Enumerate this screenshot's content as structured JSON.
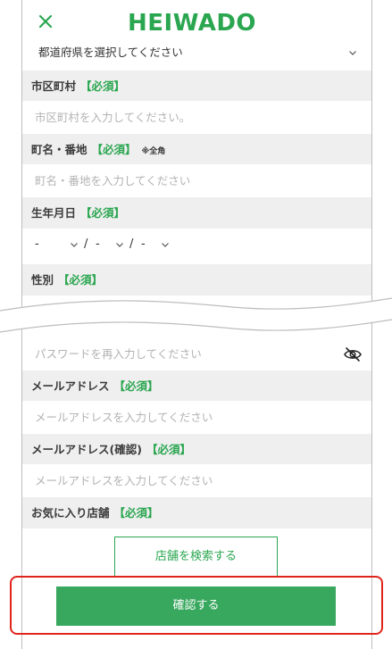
{
  "header": {
    "logo": "HEIWADO",
    "close_icon": "close-icon"
  },
  "form": {
    "prefecture_select": "都道府県を選択してください",
    "city": {
      "label": "市区町村",
      "required": "【必須】",
      "placeholder": "市区町村を入力してください。"
    },
    "street": {
      "label": "町名・番地",
      "required": "【必須】",
      "note": "※全角",
      "placeholder": "町名・番地を入力してください"
    },
    "birthdate": {
      "label": "生年月日",
      "required": "【必須】",
      "year": "-",
      "month": "-",
      "day": "-",
      "separator": "/"
    },
    "gender": {
      "label": "性別",
      "required": "【必須】"
    },
    "password_confirm": {
      "placeholder": "パスワードを再入力してください",
      "toggle_icon": "eye-off-icon"
    },
    "email": {
      "label": "メールアドレス",
      "required": "【必須】",
      "placeholder": "メールアドレスを入力してください"
    },
    "email_confirm": {
      "label": "メールアドレス(確認)",
      "required": "【必須】",
      "placeholder": "メールアドレスを入力してください"
    },
    "favorite_store": {
      "label": "お気に入り店舗",
      "required": "【必須】"
    },
    "search_store_button": "店舗を検索する",
    "confirm_button": "確認する"
  },
  "colors": {
    "brand": "#2aa650",
    "confirm_bg": "#38a85e",
    "highlight": "#e0241b",
    "label_bg": "#efefef"
  }
}
